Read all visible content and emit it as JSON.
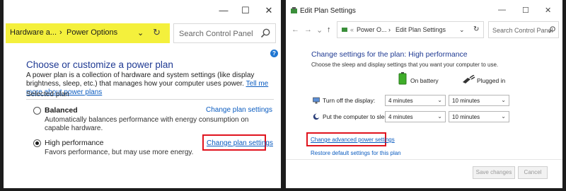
{
  "left": {
    "controls": {
      "minimize": "—",
      "maximize": "☐",
      "close": "✕"
    },
    "address": {
      "crumb1": "Hardware a...",
      "sep": "›",
      "crumb2": "Power Options",
      "chevron": "⌄",
      "refresh": "↻"
    },
    "search": {
      "placeholder": "Search Control Panel"
    },
    "help": "?",
    "heading": "Choose or customize a power plan",
    "intro": "A power plan is a collection of hardware and system settings (like display brightness, sleep, etc.) that manages how your computer uses power.",
    "intro_link": "Tell me more about power plans",
    "selected_plan_label": "Selected plan",
    "plans": [
      {
        "name": "Balanced",
        "selected": false,
        "desc": "Automatically balances performance with energy consumption on capable hardware.",
        "link": "Change plan settings"
      },
      {
        "name": "High performance",
        "selected": true,
        "desc": "Favors performance, but may use more energy.",
        "link": "Change plan settings"
      }
    ],
    "highlight_color": "#f4f03c",
    "redbox_color": "#e0141e"
  },
  "right": {
    "title": "Edit Plan Settings",
    "controls": {
      "minimize": "—",
      "maximize": "☐",
      "close": "✕"
    },
    "nav": {
      "back": "←",
      "forward": "→",
      "recent": "⌄",
      "up": "↑"
    },
    "address": {
      "crumb1": "Power O...",
      "sep": "›",
      "crumb2": "Edit Plan Settings",
      "chevron": "⌄",
      "refresh": "↻"
    },
    "search": {
      "placeholder": "Search Control Panel"
    },
    "heading": "Change settings for the plan: High performance",
    "subheading": "Choose the sleep and display settings that you want your computer to use.",
    "col_battery": "On battery",
    "col_plugged": "Plugged in",
    "rows": [
      {
        "label": "Turn off the display:",
        "battery": "4 minutes",
        "plugged": "10 minutes"
      },
      {
        "label": "Put the computer to sleep:",
        "battery": "4 minutes",
        "plugged": "10 minutes"
      }
    ],
    "advanced_link": "Change advanced power settings",
    "restore_link": "Restore default settings for this plan",
    "save_button": "Save changes",
    "cancel_button": "Cancel"
  }
}
